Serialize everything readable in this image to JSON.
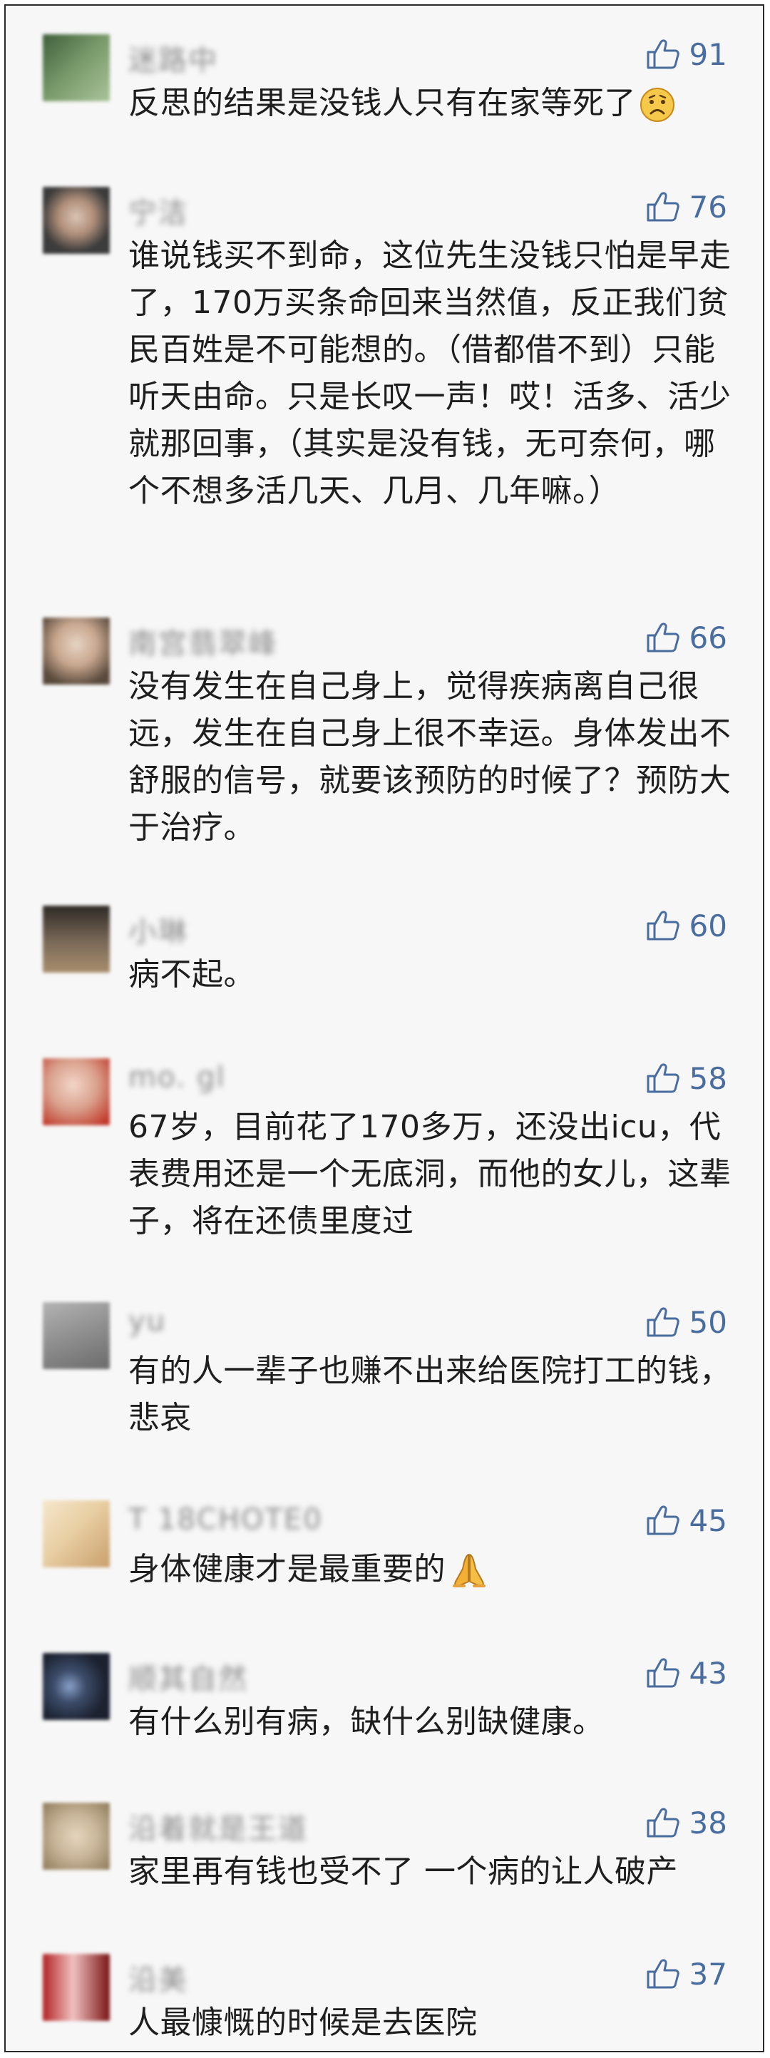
{
  "comments": [
    {
      "name": "迷路中",
      "likes": "91",
      "text": "反思的结果是没钱人只有在家等死了",
      "emoji": "sad-face",
      "avatar_colors": [
        "#3f5f3c",
        "#7a9b6b",
        "#a9c39a"
      ]
    },
    {
      "name": "宁洁",
      "likes": "76",
      "text": "谁说钱买不到命，这位先生没钱只怕是早走了，170万买条命回来当然值，反正我们贫民百姓是不可能想的。（借都借不到）只能听天由命。只是长叹一声！哎！活多、活少就那回事，（其实是没有钱，无可奈何，哪个不想多活几天、几月、几年嘛。）",
      "emoji": "",
      "avatar_colors": [
        "#3c3c3c",
        "#b08f7a",
        "#d9c4b5"
      ]
    },
    {
      "name": "南宫翡翠峰",
      "likes": "66",
      "text": "没有发生在自己身上，觉得疾病离自己很远，发生在自己身上很不幸运。身体发出不舒服的信号，就要该预防的时候了？预防大于治疗。",
      "emoji": "",
      "avatar_colors": [
        "#5a4a3c",
        "#c8a78f",
        "#e6d4c3"
      ]
    },
    {
      "name": "小琳",
      "likes": "60",
      "text": "病不起。",
      "emoji": "",
      "avatar_colors": [
        "#2e2a26",
        "#7b6a58",
        "#a88d6d"
      ]
    },
    {
      "name": "mo. gl",
      "likes": "58",
      "text": "67岁，目前花了170多万，还没出icu，代表费用还是一个无底洞，而他的女儿，这辈子，将在还债里度过",
      "emoji": "",
      "avatar_colors": [
        "#d9a08c",
        "#c0392b",
        "#f3d6c9"
      ]
    },
    {
      "name": "yu",
      "likes": "50",
      "text": "有的人一辈子也赚不出来给医院打工的钱，悲哀",
      "emoji": "",
      "avatar_colors": [
        "#6b6b6b",
        "#8e8e8e",
        "#b3b3b3"
      ]
    },
    {
      "name": "T 18CHOTE0",
      "likes": "45",
      "text": "身体健康才是最重要的",
      "emoji": "praying-hands",
      "avatar_colors": [
        "#c99f6b",
        "#e8cfa4",
        "#f5e6cc"
      ]
    },
    {
      "name": "顺其自然",
      "likes": "43",
      "text": "有什么别有病，缺什么别缺健康。",
      "emoji": "",
      "avatar_colors": [
        "#1c2230",
        "#3d4d6b",
        "#8aa0c8"
      ]
    },
    {
      "name": "沿着就是王道",
      "likes": "38",
      "text": "家里再有钱也受不了 一个病的让人破产",
      "emoji": "",
      "avatar_colors": [
        "#c9b69a",
        "#e4d5bd",
        "#8f7a5a"
      ]
    },
    {
      "name": "沿美",
      "likes": "37",
      "text": "人最慷慨的时候是去医院",
      "emoji": "",
      "avatar_colors": [
        "#b22222",
        "#7a1414",
        "#f0c0c0"
      ]
    }
  ]
}
